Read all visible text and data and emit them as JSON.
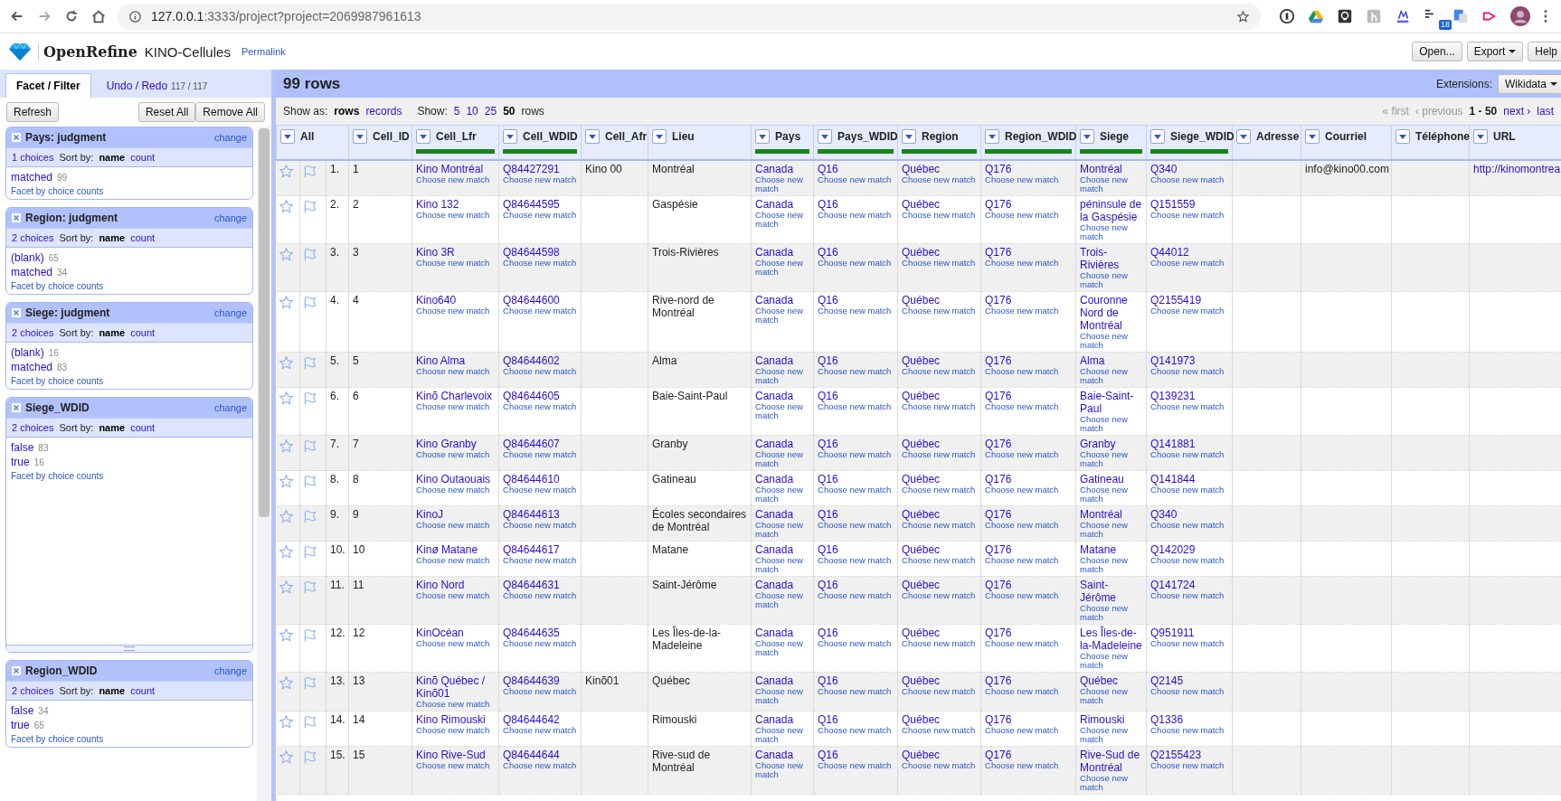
{
  "browser": {
    "url_host": "127.0.0.1",
    "url_rest": ":3333/project?project=2069987961613",
    "badge": "18"
  },
  "app": {
    "logo": "OpenRefine",
    "project": "KINO-Cellules",
    "permalink": "Permalink",
    "buttons": [
      {
        "label": "Open...",
        "dropdown": false
      },
      {
        "label": "Export",
        "dropdown": true
      },
      {
        "label": "Help",
        "dropdown": false
      }
    ]
  },
  "left_tabs": [
    {
      "label": "Facet / Filter",
      "selected": true
    },
    {
      "label": "Undo / Redo",
      "count": "117 / 117",
      "selected": false
    }
  ],
  "facet_buttons": {
    "refresh": "Refresh",
    "reset": "Reset All",
    "remove": "Remove All"
  },
  "facets": [
    {
      "title": "Pays: judgment",
      "change": "change",
      "choices_count": "1 choices",
      "sort_label": "Sort by:",
      "sort_options": [
        {
          "label": "name",
          "selected": true
        },
        {
          "label": "count",
          "selected": false
        }
      ],
      "choices": [
        {
          "label": "matched",
          "count": "99"
        }
      ],
      "footer": "Facet by choice counts",
      "resized": false
    },
    {
      "title": "Region: judgment",
      "change": "change",
      "choices_count": "2 choices",
      "sort_label": "Sort by:",
      "sort_options": [
        {
          "label": "name",
          "selected": true
        },
        {
          "label": "count",
          "selected": false
        }
      ],
      "choices": [
        {
          "label": "(blank)",
          "count": "65"
        },
        {
          "label": "matched",
          "count": "34"
        }
      ],
      "footer": "Facet by choice counts",
      "resized": false
    },
    {
      "title": "Siege: judgment",
      "change": "change",
      "choices_count": "2 choices",
      "sort_label": "Sort by:",
      "sort_options": [
        {
          "label": "name",
          "selected": true
        },
        {
          "label": "count",
          "selected": false
        }
      ],
      "choices": [
        {
          "label": "(blank)",
          "count": "16"
        },
        {
          "label": "matched",
          "count": "83"
        }
      ],
      "footer": "Facet by choice counts",
      "resized": false
    },
    {
      "title": "Siege_WDID",
      "change": "change",
      "choices_count": "2 choices",
      "sort_label": "Sort by:",
      "sort_options": [
        {
          "label": "name",
          "selected": true
        },
        {
          "label": "count",
          "selected": false
        }
      ],
      "choices": [
        {
          "label": "false",
          "count": "83"
        },
        {
          "label": "true",
          "count": "16"
        }
      ],
      "footer": "Facet by choice counts",
      "resized": true
    },
    {
      "title": "Region_WDID",
      "change": "change",
      "choices_count": "2 choices",
      "sort_label": "Sort by:",
      "sort_options": [
        {
          "label": "name",
          "selected": true
        },
        {
          "label": "count",
          "selected": false
        }
      ],
      "choices": [
        {
          "label": "false",
          "count": "34"
        },
        {
          "label": "true",
          "count": "65"
        }
      ],
      "footer": "Facet by choice counts",
      "resized": false
    }
  ],
  "grid": {
    "row_count": "99 rows",
    "extensions_label": "Extensions:",
    "extensions_button": "Wikidata",
    "show_as_label": "Show as:",
    "modes": [
      {
        "label": "rows",
        "selected": true
      },
      {
        "label": "records",
        "selected": false
      }
    ],
    "show_label": "Show:",
    "page_sizes": [
      {
        "label": "5",
        "selected": false
      },
      {
        "label": "10",
        "selected": false
      },
      {
        "label": "25",
        "selected": false
      },
      {
        "label": "50",
        "selected": true
      }
    ],
    "page_sizes_suffix": "rows",
    "pager": [
      {
        "label": "« first",
        "kind": "disabled"
      },
      {
        "label": "‹ previous",
        "kind": "disabled"
      },
      {
        "label": "1 - 50",
        "kind": "current"
      },
      {
        "label": "next ›",
        "kind": "link"
      },
      {
        "label": "last",
        "kind": "link"
      }
    ]
  },
  "all_header": "All",
  "columns": [
    {
      "label": "Cell_ID",
      "kind": "plain"
    },
    {
      "label": "Cell_Lfr",
      "kind": "matched"
    },
    {
      "label": "Cell_WDID",
      "kind": "matched"
    },
    {
      "label": "Cell_Afr",
      "kind": "plain"
    },
    {
      "label": "Lieu",
      "kind": "plain"
    },
    {
      "label": "Pays",
      "kind": "matched"
    },
    {
      "label": "Pays_WDID",
      "kind": "matched"
    },
    {
      "label": "Region",
      "kind": "matched"
    },
    {
      "label": "Region_WDID",
      "kind": "matched"
    },
    {
      "label": "Siege",
      "kind": "matched"
    },
    {
      "label": "Siege_WDID",
      "kind": "matched"
    },
    {
      "label": "Adresse",
      "kind": "plain"
    },
    {
      "label": "Courriel",
      "kind": "plain"
    },
    {
      "label": "Téléphone",
      "kind": "plain"
    },
    {
      "label": "URL",
      "kind": "link"
    }
  ],
  "rows": [
    {
      "number": "1.",
      "cells": [
        "1",
        {
          "value": "Kino Montréal",
          "action": "Choose new match"
        },
        {
          "value": "Q84427291",
          "action": "Choose new match"
        },
        "Kino 00",
        "Montréal",
        {
          "value": "Canada",
          "action": "Choose new match"
        },
        {
          "value": "Q16",
          "action": "Choose new match"
        },
        {
          "value": "Québec",
          "action": "Choose new match"
        },
        {
          "value": "Q176",
          "action": "Choose new match"
        },
        {
          "value": "Montréal",
          "action": "Choose new match"
        },
        {
          "value": "Q340",
          "action": "Choose new match"
        },
        null,
        "info@kino00.com",
        null,
        "http://kinomontrea"
      ]
    },
    {
      "number": "2.",
      "cells": [
        "2",
        {
          "value": "Kino 132",
          "action": "Choose new match"
        },
        {
          "value": "Q84644595",
          "action": "Choose new match"
        },
        null,
        "Gaspésie",
        {
          "value": "Canada",
          "action": "Choose new match"
        },
        {
          "value": "Q16",
          "action": "Choose new match"
        },
        {
          "value": "Québec",
          "action": "Choose new match"
        },
        {
          "value": "Q176",
          "action": "Choose new match"
        },
        {
          "value": "péninsule de la Gaspésie",
          "action": "Choose new match"
        },
        {
          "value": "Q151559",
          "action": "Choose new match"
        },
        null,
        null,
        null,
        null
      ]
    },
    {
      "number": "3.",
      "cells": [
        "3",
        {
          "value": "Kino 3R",
          "action": "Choose new match"
        },
        {
          "value": "Q84644598",
          "action": "Choose new match"
        },
        null,
        "Trois-Rivières",
        {
          "value": "Canada",
          "action": "Choose new match"
        },
        {
          "value": "Q16",
          "action": "Choose new match"
        },
        {
          "value": "Québec",
          "action": "Choose new match"
        },
        {
          "value": "Q176",
          "action": "Choose new match"
        },
        {
          "value": "Trois-Rivières",
          "action": "Choose new match"
        },
        {
          "value": "Q44012",
          "action": "Choose new match"
        },
        null,
        null,
        null,
        null
      ]
    },
    {
      "number": "4.",
      "cells": [
        "4",
        {
          "value": "Kino640",
          "action": "Choose new match"
        },
        {
          "value": "Q84644600",
          "action": "Choose new match"
        },
        null,
        "Rive-nord de Montréal",
        {
          "value": "Canada",
          "action": "Choose new match"
        },
        {
          "value": "Q16",
          "action": "Choose new match"
        },
        {
          "value": "Québec",
          "action": "Choose new match"
        },
        {
          "value": "Q176",
          "action": "Choose new match"
        },
        {
          "value": "Couronne Nord de Montréal",
          "action": "Choose new match"
        },
        {
          "value": "Q2155419",
          "action": "Choose new match"
        },
        null,
        null,
        null,
        null
      ]
    },
    {
      "number": "5.",
      "cells": [
        "5",
        {
          "value": "Kino Alma",
          "action": "Choose new match"
        },
        {
          "value": "Q84644602",
          "action": "Choose new match"
        },
        null,
        "Alma",
        {
          "value": "Canada",
          "action": "Choose new match"
        },
        {
          "value": "Q16",
          "action": "Choose new match"
        },
        {
          "value": "Québec",
          "action": "Choose new match"
        },
        {
          "value": "Q176",
          "action": "Choose new match"
        },
        {
          "value": "Alma",
          "action": "Choose new match"
        },
        {
          "value": "Q141973",
          "action": "Choose new match"
        },
        null,
        null,
        null,
        null
      ]
    },
    {
      "number": "6.",
      "cells": [
        "6",
        {
          "value": "Kinõ Charlevoix",
          "action": "Choose new match"
        },
        {
          "value": "Q84644605",
          "action": "Choose new match"
        },
        null,
        "Baie-Saint-Paul",
        {
          "value": "Canada",
          "action": "Choose new match"
        },
        {
          "value": "Q16",
          "action": "Choose new match"
        },
        {
          "value": "Québec",
          "action": "Choose new match"
        },
        {
          "value": "Q176",
          "action": "Choose new match"
        },
        {
          "value": "Baie-Saint-Paul",
          "action": "Choose new match"
        },
        {
          "value": "Q139231",
          "action": "Choose new match"
        },
        null,
        null,
        null,
        null
      ]
    },
    {
      "number": "7.",
      "cells": [
        "7",
        {
          "value": "Kino Granby",
          "action": "Choose new match"
        },
        {
          "value": "Q84644607",
          "action": "Choose new match"
        },
        null,
        "Granby",
        {
          "value": "Canada",
          "action": "Choose new match"
        },
        {
          "value": "Q16",
          "action": "Choose new match"
        },
        {
          "value": "Québec",
          "action": "Choose new match"
        },
        {
          "value": "Q176",
          "action": "Choose new match"
        },
        {
          "value": "Granby",
          "action": "Choose new match"
        },
        {
          "value": "Q141881",
          "action": "Choose new match"
        },
        null,
        null,
        null,
        null
      ]
    },
    {
      "number": "8.",
      "cells": [
        "8",
        {
          "value": "Kino Outaouais",
          "action": "Choose new match"
        },
        {
          "value": "Q84644610",
          "action": "Choose new match"
        },
        null,
        "Gatineau",
        {
          "value": "Canada",
          "action": "Choose new match"
        },
        {
          "value": "Q16",
          "action": "Choose new match"
        },
        {
          "value": "Québec",
          "action": "Choose new match"
        },
        {
          "value": "Q176",
          "action": "Choose new match"
        },
        {
          "value": "Gatineau",
          "action": "Choose new match"
        },
        {
          "value": "Q141844",
          "action": "Choose new match"
        },
        null,
        null,
        null,
        null
      ]
    },
    {
      "number": "9.",
      "cells": [
        "9",
        {
          "value": "KinoJ",
          "action": "Choose new match"
        },
        {
          "value": "Q84644613",
          "action": "Choose new match"
        },
        null,
        "Écoles secondaires de Montréal",
        {
          "value": "Canada",
          "action": "Choose new match"
        },
        {
          "value": "Q16",
          "action": "Choose new match"
        },
        {
          "value": "Québec",
          "action": "Choose new match"
        },
        {
          "value": "Q176",
          "action": "Choose new match"
        },
        {
          "value": "Montréal",
          "action": "Choose new match"
        },
        {
          "value": "Q340",
          "action": "Choose new match"
        },
        null,
        null,
        null,
        null
      ]
    },
    {
      "number": "10.",
      "cells": [
        "10",
        {
          "value": "Kinø Matane",
          "action": "Choose new match"
        },
        {
          "value": "Q84644617",
          "action": "Choose new match"
        },
        null,
        "Matane",
        {
          "value": "Canada",
          "action": "Choose new match"
        },
        {
          "value": "Q16",
          "action": "Choose new match"
        },
        {
          "value": "Québec",
          "action": "Choose new match"
        },
        {
          "value": "Q176",
          "action": "Choose new match"
        },
        {
          "value": "Matane",
          "action": "Choose new match"
        },
        {
          "value": "Q142029",
          "action": "Choose new match"
        },
        null,
        null,
        null,
        null
      ]
    },
    {
      "number": "11.",
      "cells": [
        "11",
        {
          "value": "Kino Nord",
          "action": "Choose new match"
        },
        {
          "value": "Q84644631",
          "action": "Choose new match"
        },
        null,
        "Saint-Jérôme",
        {
          "value": "Canada",
          "action": "Choose new match"
        },
        {
          "value": "Q16",
          "action": "Choose new match"
        },
        {
          "value": "Québec",
          "action": "Choose new match"
        },
        {
          "value": "Q176",
          "action": "Choose new match"
        },
        {
          "value": "Saint-Jérôme",
          "action": "Choose new match"
        },
        {
          "value": "Q141724",
          "action": "Choose new match"
        },
        null,
        null,
        null,
        null
      ]
    },
    {
      "number": "12.",
      "cells": [
        "12",
        {
          "value": "KinOcéan",
          "action": "Choose new match"
        },
        {
          "value": "Q84644635",
          "action": "Choose new match"
        },
        null,
        "Les Îles-de-la-Madeleine",
        {
          "value": "Canada",
          "action": "Choose new match"
        },
        {
          "value": "Q16",
          "action": "Choose new match"
        },
        {
          "value": "Québec",
          "action": "Choose new match"
        },
        {
          "value": "Q176",
          "action": "Choose new match"
        },
        {
          "value": "Les Îles-de-la-Madeleine",
          "action": "Choose new match"
        },
        {
          "value": "Q951911",
          "action": "Choose new match"
        },
        null,
        null,
        null,
        null
      ]
    },
    {
      "number": "13.",
      "cells": [
        "13",
        {
          "value": "Kinõ Québec / Kinõ01",
          "action": "Choose new match"
        },
        {
          "value": "Q84644639",
          "action": "Choose new match"
        },
        "Kinõ01",
        "Québec",
        {
          "value": "Canada",
          "action": "Choose new match"
        },
        {
          "value": "Q16",
          "action": "Choose new match"
        },
        {
          "value": "Québec",
          "action": "Choose new match"
        },
        {
          "value": "Q176",
          "action": "Choose new match"
        },
        {
          "value": "Québec",
          "action": "Choose new match"
        },
        {
          "value": "Q2145",
          "action": "Choose new match"
        },
        null,
        null,
        null,
        null
      ]
    },
    {
      "number": "14.",
      "cells": [
        "14",
        {
          "value": "Kino Rimouski",
          "action": "Choose new match"
        },
        {
          "value": "Q84644642",
          "action": "Choose new match"
        },
        null,
        "Rimouski",
        {
          "value": "Canada",
          "action": "Choose new match"
        },
        {
          "value": "Q16",
          "action": "Choose new match"
        },
        {
          "value": "Québec",
          "action": "Choose new match"
        },
        {
          "value": "Q176",
          "action": "Choose new match"
        },
        {
          "value": "Rimouski",
          "action": "Choose new match"
        },
        {
          "value": "Q1336",
          "action": "Choose new match"
        },
        null,
        null,
        null,
        null
      ]
    },
    {
      "number": "15.",
      "cells": [
        "15",
        {
          "value": "Kino Rive-Sud",
          "action": "Choose new match"
        },
        {
          "value": "Q84644644",
          "action": "Choose new match"
        },
        null,
        "Rive-sud de Montréal",
        {
          "value": "Canada",
          "action": "Choose new match"
        },
        {
          "value": "Q16",
          "action": "Choose new match"
        },
        {
          "value": "Québec",
          "action": "Choose new match"
        },
        {
          "value": "Q176",
          "action": "Choose new match"
        },
        {
          "value": "Rive-Sud de Montréal",
          "action": "Choose new match"
        },
        {
          "value": "Q2155423",
          "action": "Choose new match"
        },
        null,
        null,
        null,
        null
      ]
    }
  ]
}
